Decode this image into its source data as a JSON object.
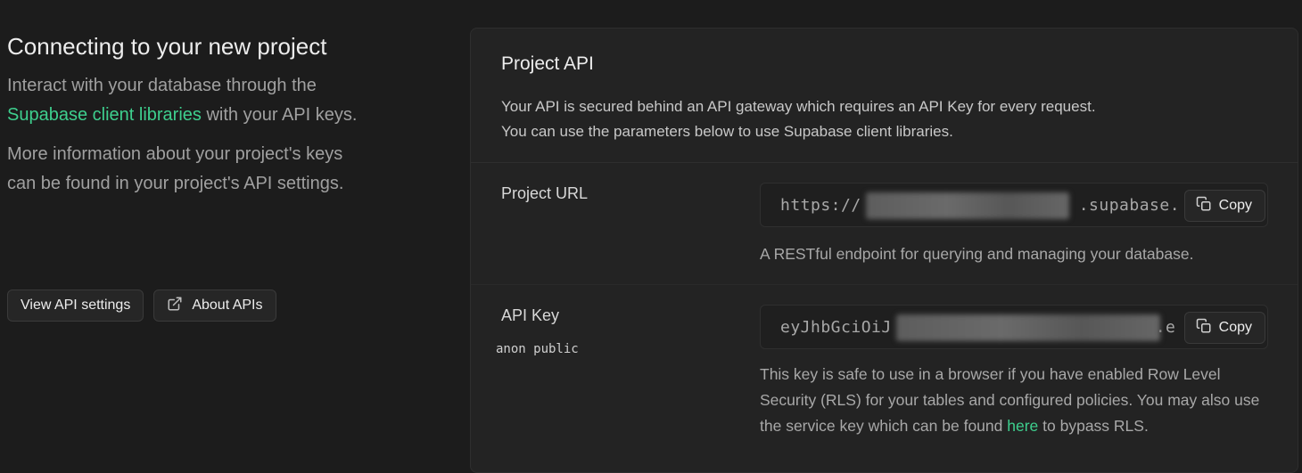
{
  "left": {
    "title": "Connecting to your new project",
    "para1_before": "Interact with your database through the ",
    "para1_link": "Supabase client libraries",
    "para1_after": " with your API keys.",
    "para2": "More information about your project's keys can be found in your project's API settings.",
    "buttons": {
      "view_api_settings": "View API settings",
      "about_apis": "About APIs"
    }
  },
  "panel": {
    "title": "Project API",
    "description_line1": "Your API is secured behind an API gateway which requires an API Key for every request.",
    "description_line2": "You can use the parameters below to use Supabase client libraries.",
    "project_url": {
      "label": "Project URL",
      "value_prefix": "https://",
      "value_suffix": ".supabase.",
      "copy_label": "Copy",
      "help": "A RESTful endpoint for querying and managing your database."
    },
    "api_key": {
      "label": "API Key",
      "sublabel": "anon public",
      "value_prefix": "eyJhbGciOiJ",
      "value_suffix": ".e",
      "copy_label": "Copy",
      "help_before": "This key is safe to use in a browser if you have enabled Row Level Security (RLS) for your tables and configured policies. You may also use the service key which can be found ",
      "help_link": "here",
      "help_after": " to bypass RLS."
    }
  },
  "colors": {
    "accent": "#3ecf8e",
    "background": "#1c1c1c",
    "panel": "#232323"
  },
  "icons": {
    "external_link": "external-link-icon",
    "copy": "copy-icon"
  }
}
